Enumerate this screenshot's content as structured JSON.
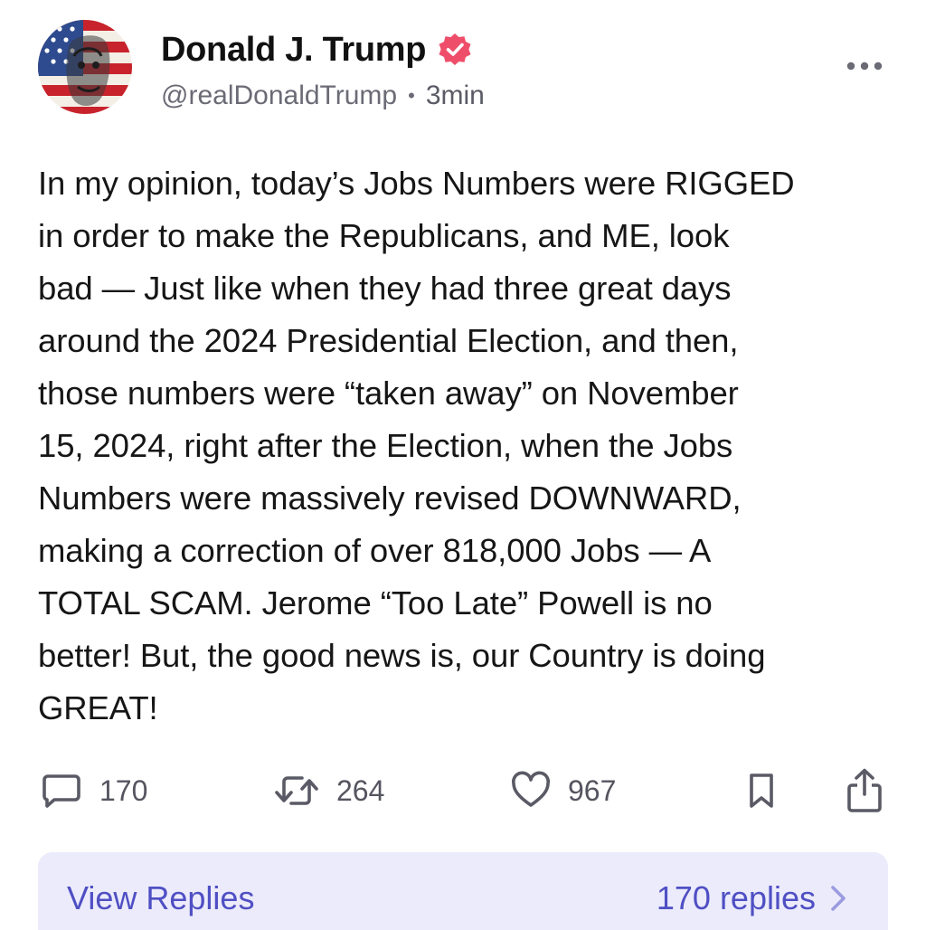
{
  "author": {
    "display_name": "Donald J. Trump",
    "handle": "@realDonaldTrump",
    "separator": "•",
    "time": "3min",
    "avatar_icon": "flag-portrait-avatar",
    "verified_icon": "verified-badge-icon",
    "verified_color": "#ef4e6a"
  },
  "menu": {
    "icon": "more-dots-icon"
  },
  "post": {
    "text": "In my opinion, today’s Jobs Numbers were RIGGED\nin order to make the Republicans, and ME, look\nbad — Just like when they had three great days\naround the 2024 Presidential Election, and then,\nthose numbers were “taken away” on November\n15, 2024, right after the Election, when the Jobs\nNumbers were massively revised DOWNWARD,\nmaking a correction of over 818,000 Jobs — A\nTOTAL SCAM. Jerome “Too Late” Powell is no\nbetter! But, the good news is, our Country is doing\nGREAT!"
  },
  "actions": {
    "reply_count": "170",
    "repost_count": "264",
    "like_count": "967",
    "icons": [
      "comment-icon",
      "repost-icon",
      "heart-icon",
      "bookmark-icon",
      "share-icon"
    ]
  },
  "replies": {
    "view_label": "View Replies",
    "count_label": "170 replies",
    "accent_color": "#4f4fc4",
    "background": "#ecebfb"
  }
}
